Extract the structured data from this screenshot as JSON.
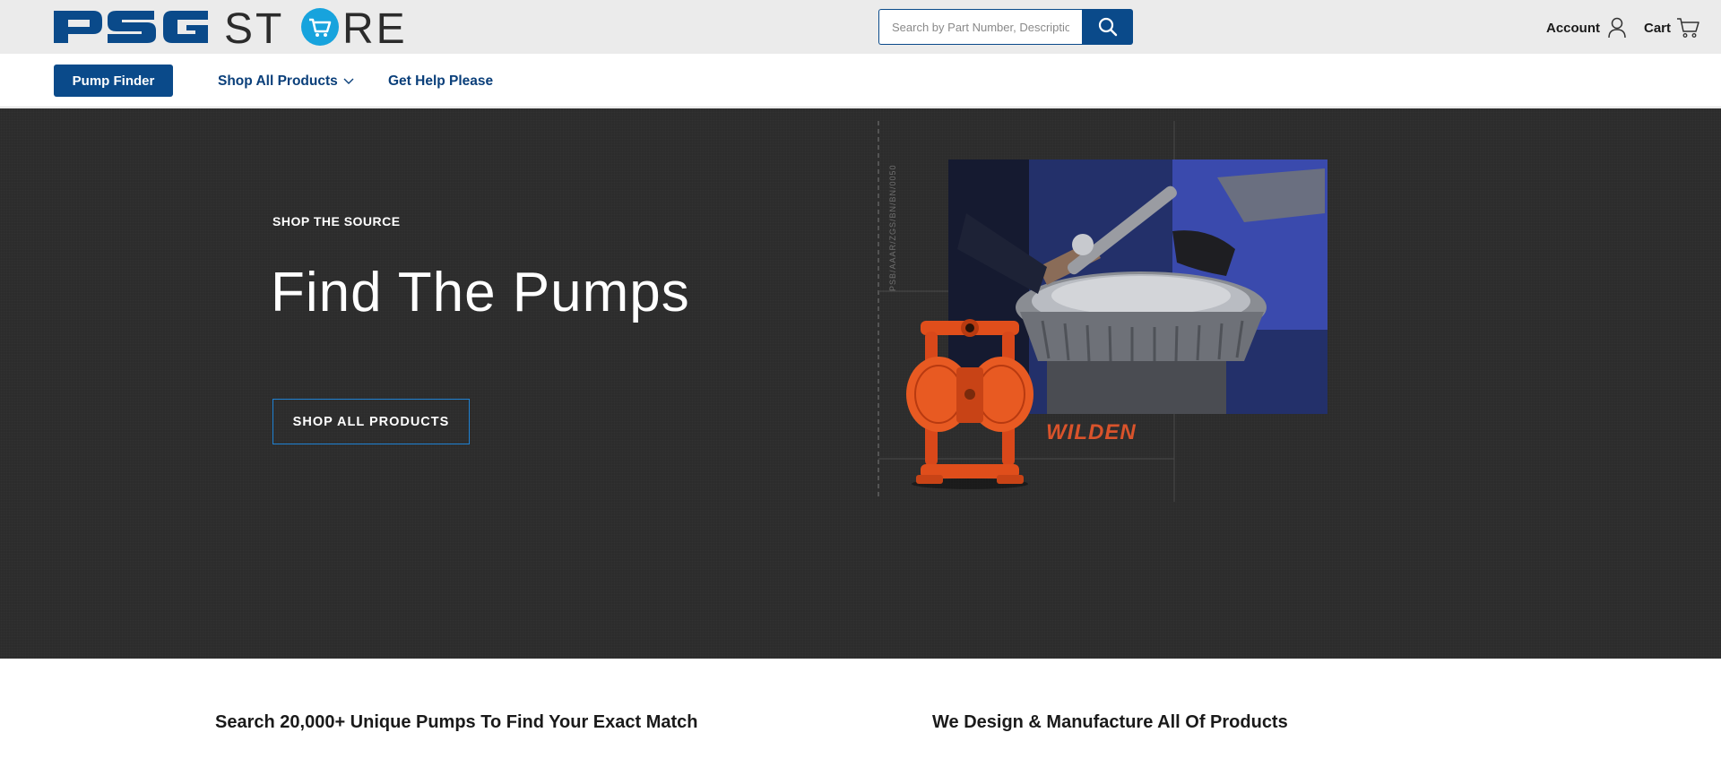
{
  "header": {
    "logo_text": "PSG STORE",
    "search": {
      "placeholder": "Search by Part Number, Description"
    },
    "account_label": "Account",
    "cart_label": "Cart"
  },
  "nav": {
    "pump_finder_label": "Pump Finder",
    "shop_all_label": "Shop All Products",
    "help_label": "Get Help Please"
  },
  "hero": {
    "eyebrow": "SHOP THE SOURCE",
    "title": "Find The Pumps",
    "button_label": "SHOP ALL PRODUCTS",
    "brand_text": "WILDEN",
    "vertical_code": "PSB/AAAR/ZGS/BN/BN/0050"
  },
  "sections": {
    "left_heading": "Search 20,000+ Unique Pumps To Find Your Exact Match",
    "right_heading": "We Design & Manufacture All Of Products"
  },
  "colors": {
    "brand_blue": "#0a4a8a",
    "logo_cyan": "#17a3dd",
    "hero_bg": "#2c2c2c",
    "pump_orange": "#e04e1b"
  },
  "icons": [
    "search-icon",
    "user-icon",
    "cart-icon",
    "chevron-down-icon"
  ]
}
